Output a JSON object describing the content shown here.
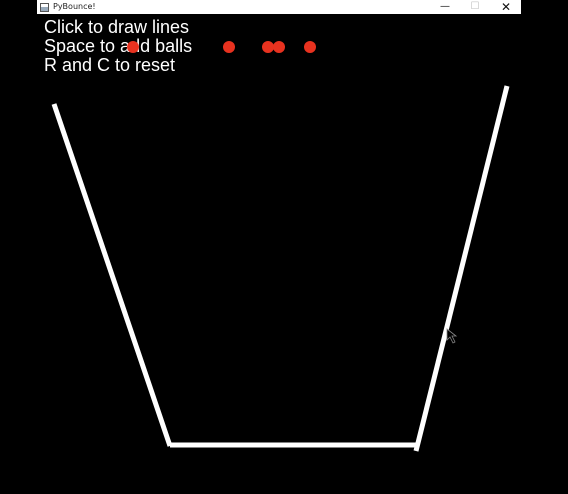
{
  "window": {
    "title": "PyBounce!",
    "minimize_glyph": "—",
    "maximize_glyph": "☐",
    "close_glyph": "✕",
    "app_icon": "window-icon"
  },
  "instructions": [
    "Click to draw lines",
    "Space to add balls",
    "R and C to reset"
  ],
  "colors": {
    "background": "#000000",
    "line": "#ffffff",
    "ball": "#e8321f"
  },
  "scene": {
    "lines": 3,
    "balls": 5
  }
}
